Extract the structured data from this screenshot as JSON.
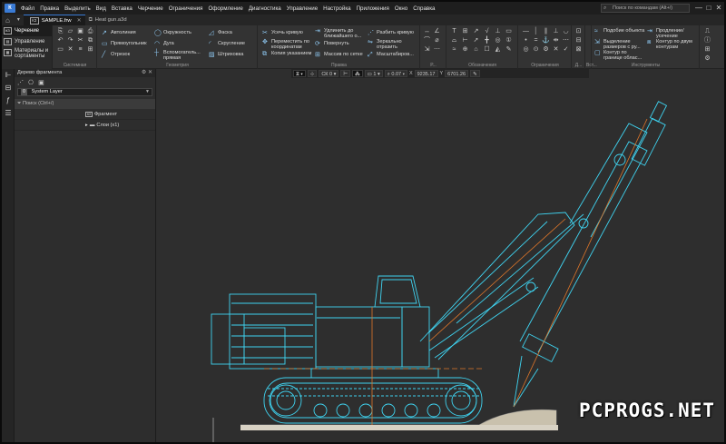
{
  "menu": {
    "items": [
      "Файл",
      "Правка",
      "Выделить",
      "Вид",
      "Вставка",
      "Черчение",
      "Ограничения",
      "Оформление",
      "Диагностика",
      "Управление",
      "Настройка",
      "Приложения",
      "Окно",
      "Справка"
    ],
    "search_placeholder": "Поиск по командам (Alt+/)",
    "minimize": "—",
    "maximize": "□",
    "close": "✕"
  },
  "tabs": {
    "home": "⌂",
    "active": "SAMPLE.frw",
    "active_close": "✕",
    "other": "Heat gun.a3d"
  },
  "ribbon": {
    "modes": [
      "Черчение",
      "Управление",
      "Материалы и сортаменты"
    ],
    "groups": {
      "system": "Системная",
      "geometry": "Геометрия",
      "edit": "Правка",
      "dims": "Р...",
      "marks": "Обозначения",
      "constraints": "Ограничения",
      "d": "Д...",
      "insert": "Вст...",
      "tools": "Инструменты"
    },
    "geometry_buttons": [
      "Автолиния",
      "Прямоугольник",
      "Отрезок",
      "Окружность",
      "Дуга",
      "Вспомогатель... прямая",
      "Фаска",
      "Скругление",
      "Штриховка"
    ],
    "edit_buttons": [
      "Усечь кривую",
      "Переместить по координатам",
      "Копия указанием",
      "Удлинить до ближайшего о...",
      "Повернуть",
      "Массив по сетке",
      "Разбить кривую",
      "Зеркально отразить",
      "Масштабиров..."
    ],
    "tools_buttons": [
      "Подобие объекта",
      "Выделение размеров с ру...",
      "Контур по границе облас...",
      "Продление/усечение",
      "Контур по двум контурам"
    ]
  },
  "panel": {
    "title": "Дерево фрагмента",
    "layer": "System Layer",
    "layer_index": "0",
    "search": "Поиск (Ctrl+/)",
    "tree": [
      {
        "label": "Фрагмент",
        "icon": "fragment-icon"
      },
      {
        "label": "Слои (x1)",
        "icon": "layers-icon"
      }
    ]
  },
  "canvas_toolbar": {
    "sk": "СК 0",
    "layer_no": "1",
    "scale": "0.07",
    "x_label": "X",
    "x_value": "9235.17",
    "y_label": "Y",
    "y_value": "6701.26"
  },
  "watermark": "PCPROGS.NET",
  "colors": {
    "accent": "#3a7bd5",
    "drawing_lines": "#3fd3f0",
    "axis_lines": "#e0772a",
    "background": "#2e2e2e"
  }
}
